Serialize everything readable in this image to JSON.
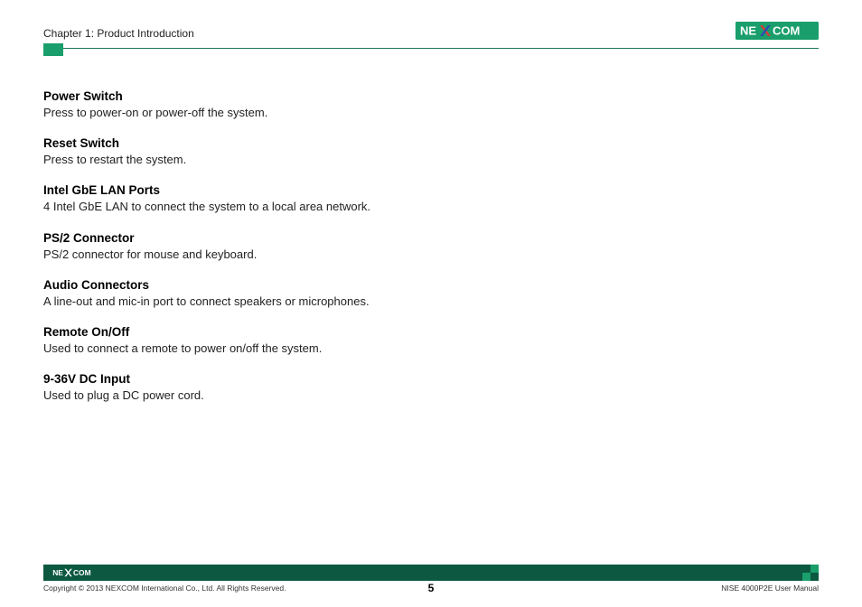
{
  "header": {
    "chapter": "Chapter 1: Product Introduction",
    "brand": "NEXCOM"
  },
  "sections": [
    {
      "title": "Power Switch",
      "body": "Press to power-on or power-off the system."
    },
    {
      "title": "Reset Switch",
      "body": "Press to restart the system."
    },
    {
      "title": "Intel GbE LAN Ports",
      "body": "4 Intel GbE LAN to connect the system to a local area network."
    },
    {
      "title": "PS/2 Connector",
      "body": "PS/2 connector for mouse and keyboard."
    },
    {
      "title": "Audio Connectors",
      "body": "A line-out and mic-in port to connect speakers or microphones."
    },
    {
      "title": "Remote On/Off",
      "body": "Used to connect a remote to power on/off the system."
    },
    {
      "title": "9-36V DC Input",
      "body": "Used to plug a DC power cord."
    }
  ],
  "footer": {
    "copyright": "Copyright © 2013 NEXCOM International Co., Ltd. All Rights Reserved.",
    "page": "5",
    "manual": "NISE 4000P2E User Manual",
    "brand": "NEXCOM"
  }
}
